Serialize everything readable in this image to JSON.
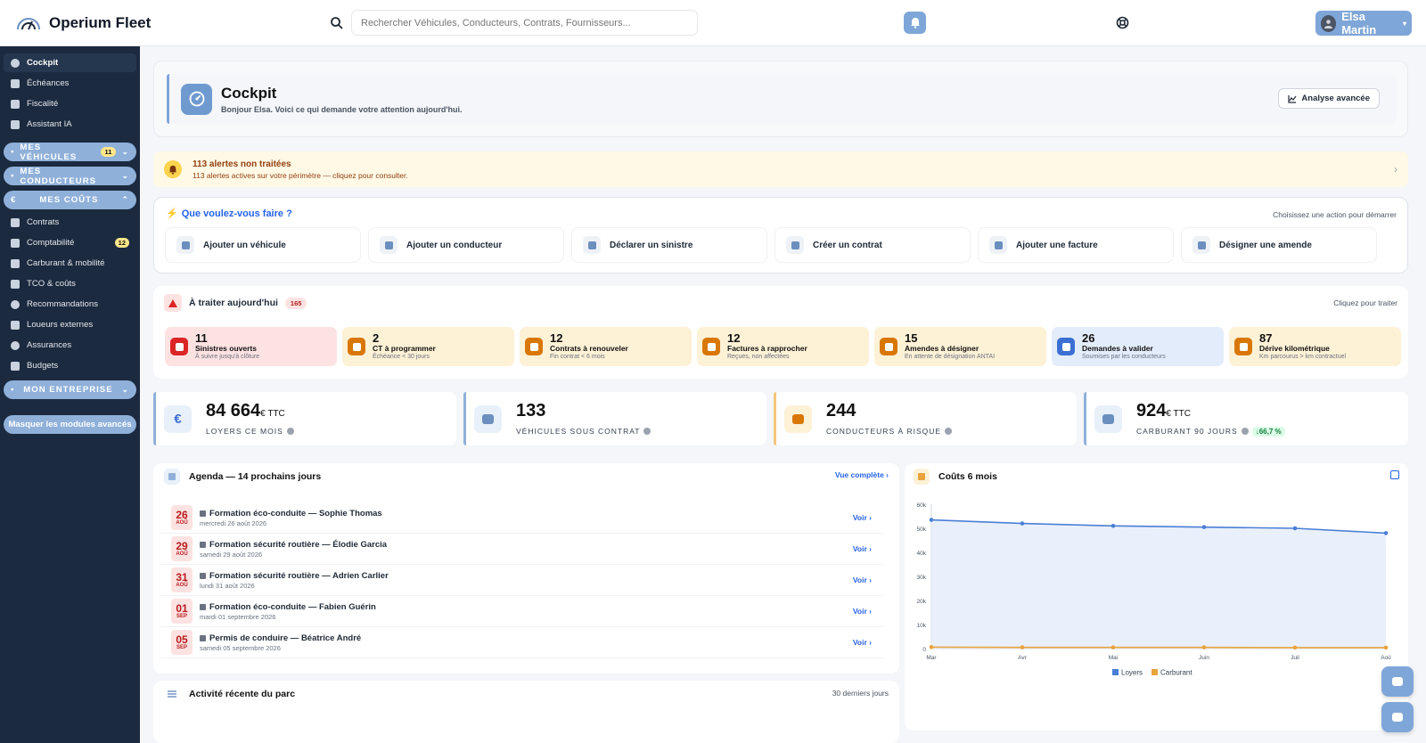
{
  "app": {
    "name": "Operium Fleet"
  },
  "search": {
    "placeholder": "Rechercher Véhicules, Conducteurs, Contrats, Fournisseurs..."
  },
  "user": {
    "name": "Elsa Martin"
  },
  "sidebar": {
    "top_items": [
      {
        "label": "Cockpit",
        "icon": "gauge-icon"
      },
      {
        "label": "Échéances",
        "icon": "calendar-icon"
      },
      {
        "label": "Fiscalité",
        "icon": "document-icon"
      },
      {
        "label": "Assistant IA",
        "icon": "robot-icon"
      }
    ],
    "sections": {
      "vehicles": {
        "label": "MES VÉHICULES",
        "count": "11"
      },
      "drivers": {
        "label": "MES CONDUCTEURS"
      },
      "costs": {
        "label": "MES COÛTS"
      },
      "company": {
        "label": "MON ENTREPRISE"
      }
    },
    "cost_items": [
      {
        "label": "Contrats"
      },
      {
        "label": "Comptabilité",
        "badge": "12"
      },
      {
        "label": "Carburant & mobilité"
      },
      {
        "label": "TCO & coûts"
      },
      {
        "label": "Recommandations"
      },
      {
        "label": "Loueurs externes"
      },
      {
        "label": "Assurances"
      },
      {
        "label": "Budgets"
      }
    ],
    "hide_button": "Masquer les modules avancés"
  },
  "header": {
    "title": "Cockpit",
    "subtitle": "Bonjour Elsa. Voici ce qui demande votre attention aujourd'hui.",
    "analyse_button": "Analyse avancée"
  },
  "alerts": {
    "title": "113 alertes non traitées",
    "subtitle": "113 alertes actives sur votre périmètre — cliquez pour consulter."
  },
  "quick_actions": {
    "title": "Que voulez-vous faire ?",
    "hint": "Choisissez une action pour démarrer",
    "items": [
      {
        "label": "Ajouter un véhicule",
        "icon": "plus-circle-icon"
      },
      {
        "label": "Ajouter un conducteur",
        "icon": "user-plus-icon"
      },
      {
        "label": "Déclarer un sinistre",
        "icon": "car-crash-icon"
      },
      {
        "label": "Créer un contrat",
        "icon": "file-contract-icon"
      },
      {
        "label": "Ajouter une facture",
        "icon": "invoice-icon"
      },
      {
        "label": "Désigner une amende",
        "icon": "gavel-icon"
      }
    ]
  },
  "todo": {
    "title": "À traiter aujourd'hui",
    "count": "165",
    "hint": "Cliquez pour traiter",
    "tiles": [
      {
        "num": "11",
        "label": "Sinistres ouverts",
        "sub": "À suivre jusqu'à clôture",
        "bg": "#fde2e2",
        "icon_bg": "#dc2626"
      },
      {
        "num": "2",
        "label": "CT à programmer",
        "sub": "Échéance < 30 jours",
        "bg": "#fdf1d6",
        "icon_bg": "#d97706"
      },
      {
        "num": "12",
        "label": "Contrats à renouveler",
        "sub": "Fin contrat < 6 mois",
        "bg": "#fdf1d6",
        "icon_bg": "#d97706"
      },
      {
        "num": "12",
        "label": "Factures à rapprocher",
        "sub": "Reçues, non affectées",
        "bg": "#fdf1d6",
        "icon_bg": "#d97706"
      },
      {
        "num": "15",
        "label": "Amendes à désigner",
        "sub": "En attente de désignation ANTAI",
        "bg": "#fdf1d6",
        "icon_bg": "#d97706"
      },
      {
        "num": "26",
        "label": "Demandes à valider",
        "sub": "Soumises par les conducteurs",
        "bg": "#e3ecfa",
        "icon_bg": "#3b6fd4"
      },
      {
        "num": "87",
        "label": "Dérive kilométrique",
        "sub": "Km parcourus > km contractuel",
        "bg": "#fdf1d6",
        "icon_bg": "#d97706"
      }
    ]
  },
  "kpis": [
    {
      "value": "84 664",
      "unit": "€ TTC",
      "label": "LOYERS CE MOIS",
      "icon": "euro-icon",
      "accent": "#8fb0d9",
      "icon_bg": "#e8f0fa",
      "icon_fg": "#3b6fd4",
      "glyph": "€"
    },
    {
      "value": "133",
      "unit": "",
      "label": "VÉHICULES SOUS CONTRAT",
      "icon": "car-icon",
      "accent": "#8fb0d9",
      "icon_bg": "#e8f0fa",
      "icon_fg": "#6b8fbf",
      "glyph": ""
    },
    {
      "value": "244",
      "unit": "",
      "label": "CONDUCTEURS À RISQUE",
      "icon": "user-warning-icon",
      "accent": "#f5c57a",
      "icon_bg": "#fdf1d6",
      "icon_fg": "#d97706",
      "glyph": ""
    },
    {
      "value": "924",
      "unit": "€ TTC",
      "label": "CARBURANT 90 JOURS",
      "icon": "fuel-icon",
      "accent": "#8fb0d9",
      "icon_bg": "#e8f0fa",
      "icon_fg": "#6b8fbf",
      "glyph": "",
      "delta": "↓66,7 %"
    }
  ],
  "agenda": {
    "title": "Agenda — 14 prochains jours",
    "link": "Vue complète",
    "items": [
      {
        "day": "26",
        "month": "AOÛ",
        "title": "Formation éco-conduite — Sophie Thomas",
        "date": "mercredi 26 août 2026",
        "action": "Voir"
      },
      {
        "day": "29",
        "month": "AOÛ",
        "title": "Formation sécurité routière — Élodie Garcia",
        "date": "samedi 29 août 2026",
        "action": "Voir"
      },
      {
        "day": "31",
        "month": "AOÛ",
        "title": "Formation sécurité routière — Adrien Carlier",
        "date": "lundi 31 août 2026",
        "action": "Voir"
      },
      {
        "day": "01",
        "month": "SEP",
        "title": "Formation éco-conduite — Fabien Guérin",
        "date": "mardi 01 septembre 2026",
        "action": "Voir"
      },
      {
        "day": "05",
        "month": "SEP",
        "title": "Permis de conduire — Béatrice André",
        "date": "samedi 05 septembre 2026",
        "action": "Voir"
      }
    ]
  },
  "costs": {
    "title": "Coûts 6 mois"
  },
  "chart_data": {
    "type": "area",
    "title": "Coûts 6 mois",
    "categories": [
      "Mar",
      "Avr",
      "Mai",
      "Juin",
      "Juil",
      "Aoû"
    ],
    "series": [
      {
        "name": "Loyers",
        "values": [
          53500,
          52000,
          51000,
          50500,
          50000,
          48000
        ],
        "color": "#4a7fd6"
      },
      {
        "name": "Carburant",
        "values": [
          600,
          500,
          500,
          500,
          400,
          400
        ],
        "color": "#e8a33c"
      }
    ],
    "y_ticks": [
      "0",
      "10k",
      "20k",
      "30k",
      "40k",
      "50k",
      "60k"
    ],
    "ylim": [
      0,
      60000
    ],
    "grid": false,
    "legend": "bottom"
  },
  "activity": {
    "title": "Activité récente du parc",
    "hint": "30 derniers jours"
  }
}
